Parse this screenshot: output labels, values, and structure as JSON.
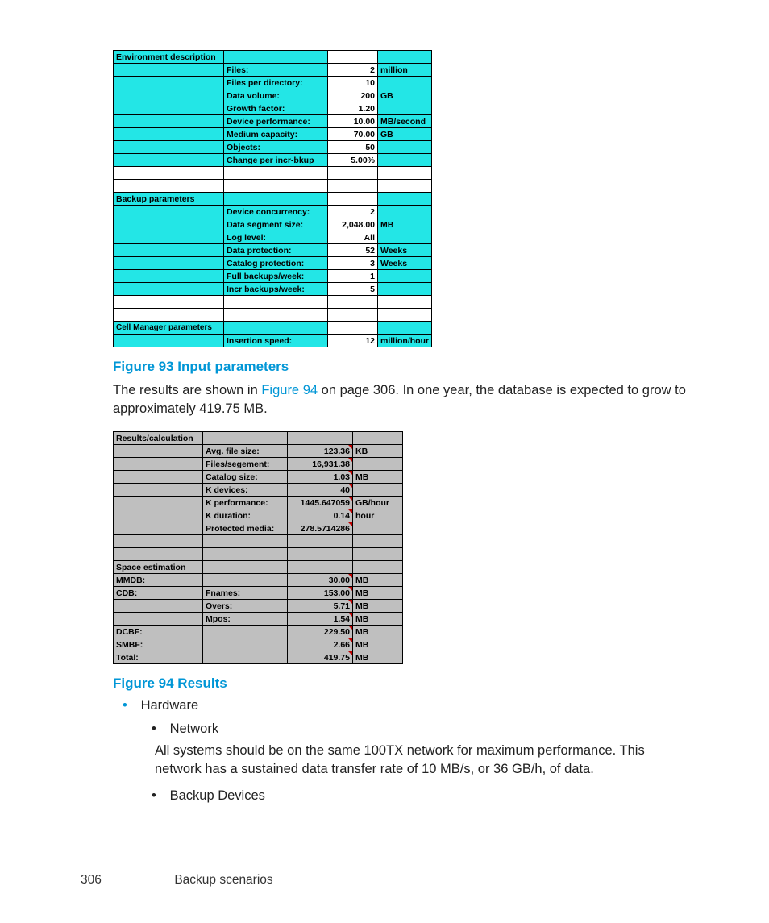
{
  "table1": {
    "section1_header": "Environment description",
    "rows1": [
      {
        "label": "Files:",
        "value": "2",
        "unit": "million"
      },
      {
        "label": "Files per directory:",
        "value": "10",
        "unit": ""
      },
      {
        "label": "Data volume:",
        "value": "200",
        "unit": "GB"
      },
      {
        "label": "Growth factor:",
        "value": "1.20",
        "unit": ""
      },
      {
        "label": "Device performance:",
        "value": "10.00",
        "unit": "MB/second"
      },
      {
        "label": "Medium capacity:",
        "value": "70.00",
        "unit": "GB"
      },
      {
        "label": "Objects:",
        "value": "50",
        "unit": ""
      },
      {
        "label": "Change per incr-bkup",
        "value": "5.00%",
        "unit": ""
      }
    ],
    "section2_header": "Backup parameters",
    "rows2": [
      {
        "label": "Device concurrency:",
        "value": "2",
        "unit": ""
      },
      {
        "label": "Data segment size:",
        "value": "2,048.00",
        "unit": "MB"
      },
      {
        "label": "Log level:",
        "value": "All",
        "unit": ""
      },
      {
        "label": "Data protection:",
        "value": "52",
        "unit": "Weeks"
      },
      {
        "label": "Catalog protection:",
        "value": "3",
        "unit": "Weeks"
      },
      {
        "label": "Full backups/week:",
        "value": "1",
        "unit": ""
      },
      {
        "label": "Incr backups/week:",
        "value": "5",
        "unit": ""
      }
    ],
    "section3_header": "Cell Manager parameters",
    "rows3": [
      {
        "label": "Insertion speed:",
        "value": "12",
        "unit": "million/hour"
      }
    ]
  },
  "caption1": "Figure 93 Input parameters",
  "paragraph1_a": "The results are shown in ",
  "paragraph1_link": "Figure 94",
  "paragraph1_b": " on page 306. In one year, the database is expected to grow to approximately 419.75 MB.",
  "table2": {
    "section1_header": "Results/calculation",
    "rows1": [
      {
        "label": "Avg. file size:",
        "value": "123.36",
        "unit": "KB"
      },
      {
        "label": "Files/segement:",
        "value": "16,931.38",
        "unit": ""
      },
      {
        "label": "Catalog size:",
        "value": "1.03",
        "unit": "MB"
      },
      {
        "label": "K devices:",
        "value": "40",
        "unit": ""
      },
      {
        "label": "K performance:",
        "value": "1445.647059",
        "unit": "GB/hour"
      },
      {
        "label": "K duration:",
        "value": "0.14",
        "unit": "hour"
      },
      {
        "label": "Protected media:",
        "value": "278.5714286",
        "unit": ""
      }
    ],
    "section2_header": "Space estimation",
    "rows2a": [
      {
        "rowlabel": "MMDB:",
        "label": "",
        "value": "30.00",
        "unit": "MB"
      }
    ],
    "cdb_header": "CDB:",
    "rows2b": [
      {
        "label": "Fnames:",
        "value": "153.00",
        "unit": "MB"
      },
      {
        "label": "Overs:",
        "value": "5.71",
        "unit": "MB"
      },
      {
        "label": "Mpos:",
        "value": "1.54",
        "unit": "MB"
      }
    ],
    "rows2c": [
      {
        "rowlabel": "DCBF:",
        "label": "",
        "value": "229.50",
        "unit": "MB"
      },
      {
        "rowlabel": "SMBF:",
        "label": "",
        "value": "2.66",
        "unit": "MB"
      },
      {
        "rowlabel": "Total:",
        "label": "",
        "value": "419.75",
        "unit": "MB"
      }
    ]
  },
  "caption2": "Figure 94 Results",
  "bullets": {
    "l1": "Hardware",
    "l2a": "Network",
    "l2a_body": "All systems should be on the same 100TX network for maximum performance. This network has a sustained data transfer rate of 10 MB/s, or 36 GB/h, of data.",
    "l2b": "Backup Devices"
  },
  "footer": {
    "page": "306",
    "title": "Backup scenarios"
  }
}
